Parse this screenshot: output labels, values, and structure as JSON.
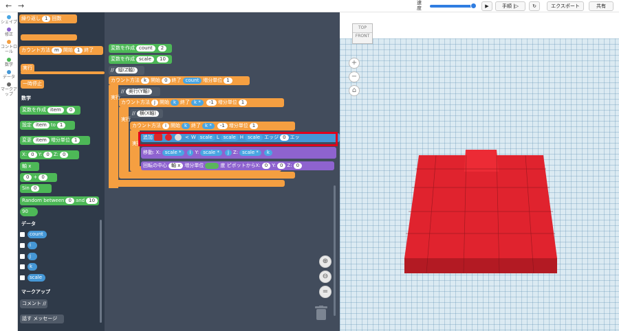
{
  "topbar": {
    "back": "←",
    "forward": "→",
    "speed_label": "速度",
    "play": "▶",
    "step_label": "手順",
    "step_icon": "|▷",
    "reset": "↻",
    "export": "エクスポート",
    "share": "共有"
  },
  "nav": [
    {
      "label": "シェイプ",
      "color": "#4aa6e3"
    },
    {
      "label": "修正",
      "color": "#8e63cf"
    },
    {
      "label": "コントロール",
      "color": "#f59f41"
    },
    {
      "label": "数学",
      "color": "#4db857"
    },
    {
      "label": "データ",
      "color": "#4597d6"
    },
    {
      "label": "マークアップ",
      "color": "#666666"
    }
  ],
  "palette": {
    "repeat": "繰り返し",
    "repeat_n": "1",
    "repeat_unit": "回数",
    "count": "カウント方法",
    "count_var": "m",
    "start": "開始",
    "start_v": "1",
    "end": "終了",
    "exec": "実行",
    "pause": "一時停止",
    "math": "数学",
    "create_var": "変数を作成",
    "item": "item",
    "item_v": "0",
    "set": "設定",
    "set_to": "to",
    "set_v": "1",
    "change": "変更",
    "step": "増分単位",
    "change_v": "1",
    "x": "X:",
    "y": "Y:",
    "z": "Z:",
    "zero": "0",
    "axis": "軸 x",
    "plus": "+",
    "sin": "Sin",
    "rand": "Random between",
    "rand_a": "0",
    "and": "and",
    "rand_b": "10",
    "ninety": "90",
    "data": "データ",
    "d1": "count",
    "d2": "i",
    "d3": "j",
    "d4": "k",
    "d5": "scale",
    "markup": "マークアップ",
    "comment": "コメント //",
    "say": "話す",
    "message": "メッセージ"
  },
  "ws": {
    "b1": "変数を作成",
    "b1v": "count",
    "b1n": "2",
    "b2": "変数を作成",
    "b2v": "scale",
    "b2n": "10",
    "c1": "//",
    "c1t": "縦(Z軸)",
    "loop1": "カウント方法",
    "loop1v": "k",
    "start": "開始",
    "zero": "0",
    "end": "終了",
    "count": "count",
    "step": "増分単位",
    "one": "1",
    "exec": "実行",
    "c2": "//",
    "c2t": "奥行(Y軸)",
    "loop2": "カウント方法",
    "loop2v": "j",
    "k": "k",
    "star": "*",
    "minus1": "-1",
    "c3": "//",
    "c3t": "横(X軸)",
    "loop3": "カウント方法",
    "loop3v": "i",
    "add": "追加",
    "W": "W",
    "L": "L",
    "H": "H",
    "scale": "scale",
    "edge": "エッジ",
    "edge_v": "0",
    "edge2": "エッ",
    "move": "移動:",
    "mx": "X:",
    "my": "Y:",
    "mz": "Z:",
    "i": "i",
    "j": "j",
    "rot": "回転の中心",
    "rot_axis": "軸 x",
    "rot_step": "増分単位",
    "deg_label": "度",
    "pivot": "ピボットから",
    "rx": "X:",
    "ry": "Y:",
    "rz": "Z:"
  },
  "view": {
    "top": "TOP",
    "front": "FRONT",
    "plus": "+",
    "minus": "−",
    "home": "⌂"
  },
  "colors": {
    "block_red": "#e0232e",
    "highlight": "#e0001b"
  }
}
